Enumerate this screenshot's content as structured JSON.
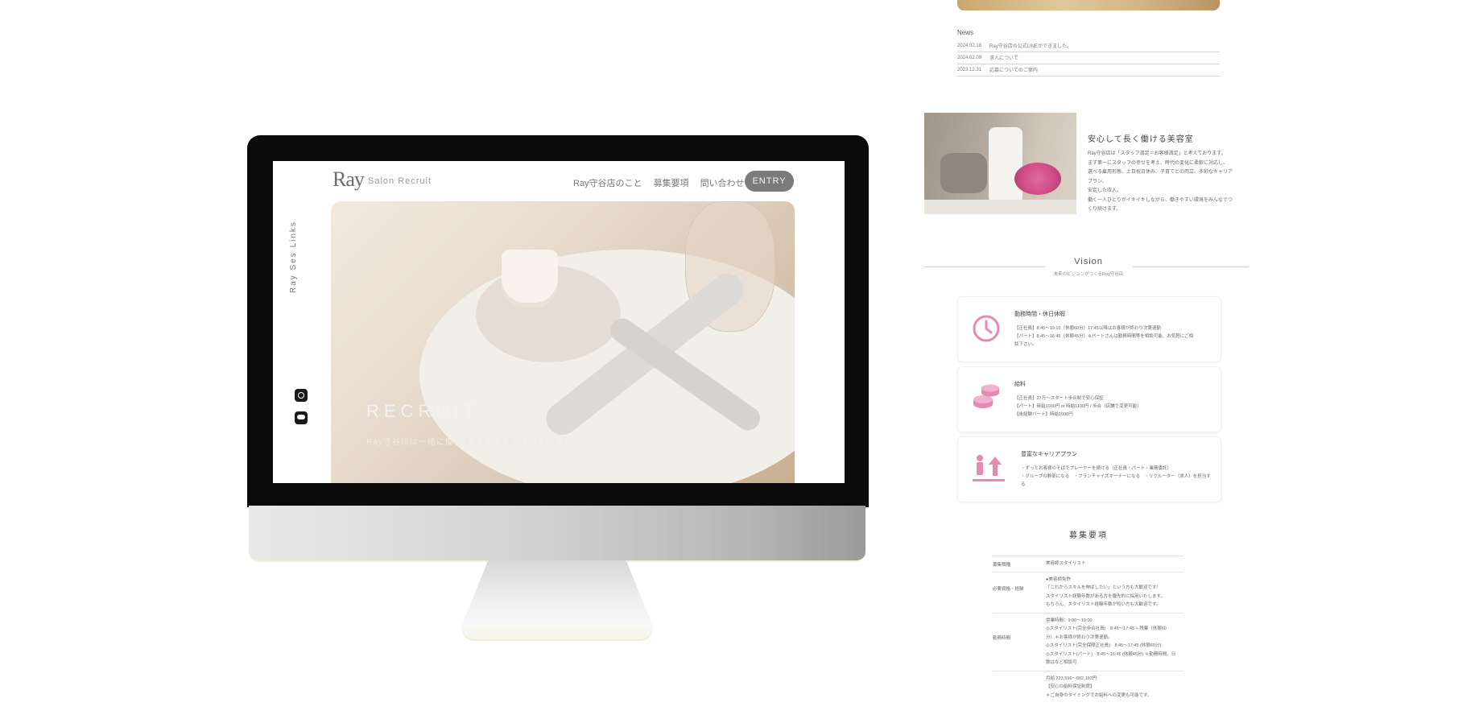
{
  "mockup": {
    "logo": "Ray",
    "logo_sub": "Salon Recruit",
    "nav": [
      "Ray守谷店のこと",
      "募集要項",
      "問い合わせ"
    ],
    "entry_label": "ENTRY",
    "vertical_text": "Ray Ses Links",
    "hero_title": "RECRUIT",
    "hero_subtitle": "Ray守谷店は一緒に働けるあなたを歓迎しています",
    "sns_icons": [
      "instagram-icon",
      "line-icon"
    ]
  },
  "news": {
    "heading": "News",
    "items": [
      {
        "date": "2024.02.18",
        "title": "Ray守谷店の公式LINEができました。"
      },
      {
        "date": "2024.02.09",
        "title": "求人について"
      },
      {
        "date": "2023.12.31",
        "title": "応募についてのご案内"
      }
    ]
  },
  "feature": {
    "title": "安心して長く働ける美容室",
    "lines": [
      "Ray守谷店は「スタッフ満足＝お客様満足」と考えております。",
      "まず第一にスタッフの幸せを考え、時代の変化に柔軟に対応し、",
      "選べる雇用形態、土日祝日休み、子育てとの両立、多彩なキャリアプラン、",
      "安定した収入。",
      "働く一人ひとりがイキイキしながら、働きやすい環境をみんなでつくり続けます。"
    ]
  },
  "vision": {
    "title": "Vision",
    "subtitle": "未来のビジョンがつくるRay守谷店"
  },
  "cards": [
    {
      "icon": "clock-icon",
      "title": "勤務時間・休日休暇",
      "lines": [
        "【正社員】8:45～19:15（休憩60分）17:45以降はお客様が終わり次第退勤",
        "【パート】8:45～16:45（休憩45分）※パートさんは勤務時間等を相談可能、お気軽にご相",
        "談下さい。"
      ]
    },
    {
      "icon": "coins-icon",
      "title": "給料",
      "lines": [
        "【正社員】27万～スタート歩合制で安心保証",
        "【パート】時給1000円 or 時給1100円 / 歩合（店舗で変更可能）",
        "【未経験パート】時給1000円"
      ]
    },
    {
      "icon": "career-icon",
      "title": "豊富なキャリアプラン",
      "lines": [
        "・ずっとお客様のそばでプレーヤーを続ける（正社員・パート・業務委託）",
        "・グループの幹部になる　・フランチャイズオーナーになる　・リクルーター（求人）を担当する"
      ]
    }
  ],
  "requirements": {
    "title": "募集要項",
    "rows": [
      {
        "label": "募集職種",
        "lines": [
          "美容師スタイリスト"
        ]
      },
      {
        "label": "必要資格・経験",
        "lines": [
          "●美容師免許",
          "「これからスキルを伸ばしたい」という方も大歓迎です！",
          "スタイリスト経験年数がある方を優先的に採用いたします。",
          "もちろん、スタイリスト経験年数が短い方も大歓迎です。"
        ]
      },
      {
        "label": "勤務時間",
        "lines": [
          "営業時間：9:00～19:00",
          "◎スタイリスト(完全歩合社員)　8:45～17:45 + 残業（休憩60",
          "分）＊お客様が終わり次第退勤。",
          "◎スタイリスト(完全保障正社員)　8:45～17:45 (休憩60分)",
          "◎スタイリスト(パート)　8:45～16:45 (休憩45分) ＊勤務時間、日",
          "数はなど相談可"
        ]
      },
      {
        "label": "",
        "lines": [
          "月給 223,596～882,192円",
          "【安心の給料保証制度】",
          "＊ご自身のタイミングでお給料への変更も可能です。"
        ]
      }
    ]
  }
}
